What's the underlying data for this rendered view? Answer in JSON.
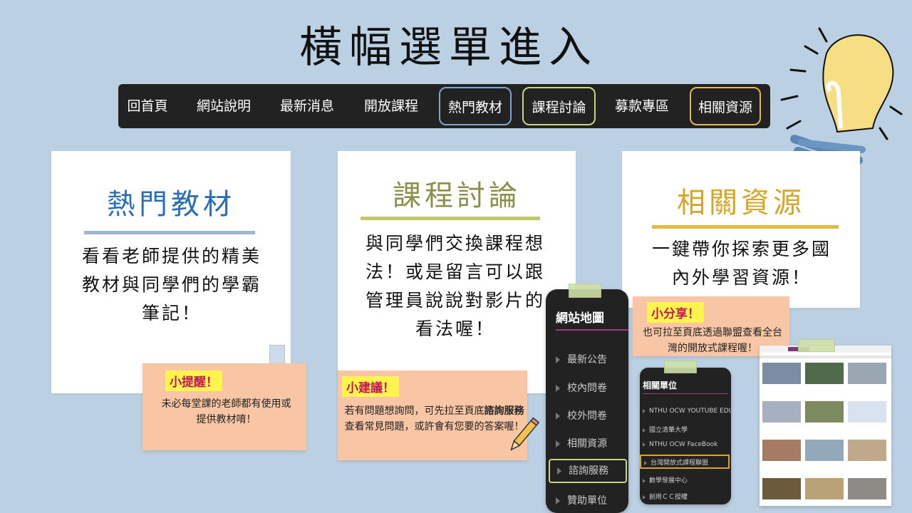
{
  "title": "橫幅選單進入",
  "nav": [
    {
      "label": "回首頁"
    },
    {
      "label": "網站說明"
    },
    {
      "label": "最新消息"
    },
    {
      "label": "開放課程"
    },
    {
      "label": "熱門教材"
    },
    {
      "label": "課程討論"
    },
    {
      "label": "募款專區"
    },
    {
      "label": "相關資源"
    }
  ],
  "cards": {
    "hot": {
      "title": "熱門教材",
      "body": "看看老師提供的精美教材與同學們的學霸筆記！",
      "note_tag": "小提醒！",
      "note_text": "未必每堂課的老師都有使用或提供教材唷！"
    },
    "discuss": {
      "title": "課程討論",
      "body": "與同學們交換課程想法！或是留言可以跟管理員說說對影片的看法喔！",
      "note_tag": "小建議！",
      "note_text_1": "若有問題想詢問，可先拉至頁底",
      "note_text_bold": "諮詢服務",
      "note_text_2": "查看常見問題，或許會有您要的答案喔！"
    },
    "resources": {
      "title": "相關資源",
      "body": "一鍵帶你探索更多國內外學習資源！",
      "note_tag": "小分享！",
      "note_text": "也可拉至頁底透過聯盟查看全台灣的開放式課程喔！"
    }
  },
  "sitemap": {
    "title": "網站地圖",
    "items": [
      "最新公告",
      "校內問卷",
      "校外問卷",
      "相關資源",
      "諮詢服務",
      "贊助單位"
    ]
  },
  "related": {
    "title": "相關單位",
    "items": [
      "NTHU OCW YOUTUBE EDU",
      "國立清華大學",
      "NTHU OCW FaceBook",
      "台灣開放式課程聯盟",
      "數學發展中心",
      "創用ＣＣ授權"
    ]
  },
  "colors": {
    "blue": "#2a6fb5",
    "green": "#8a8f4a",
    "gold": "#d4a526",
    "nav_bg": "#222222"
  }
}
